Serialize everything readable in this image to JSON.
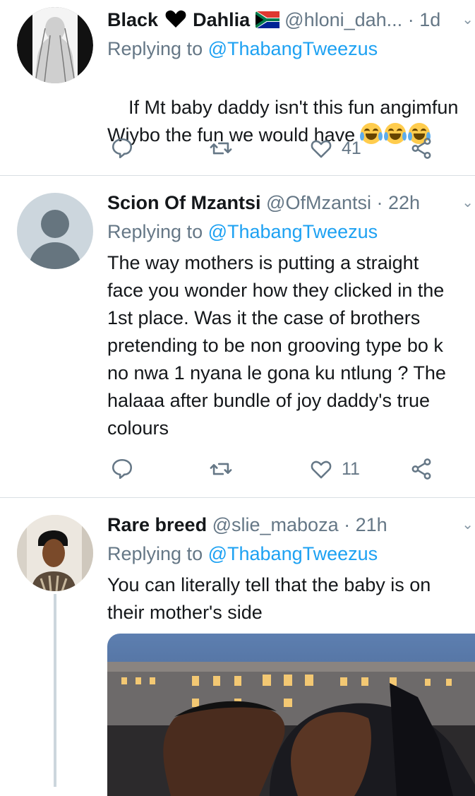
{
  "tweets": [
    {
      "name": "Black",
      "name_suffix": "Dahlia",
      "handle": "@hloni_dah...",
      "time": "1d",
      "reply_prefix": "Replying to",
      "reply_to": "@ThabangTweezus",
      "text": "If Mt baby daddy isn't this fun angimfun\nWiybo the fun we would have",
      "emojis": [
        "face-with-tears-of-joy",
        "face-with-tears-of-joy",
        "face-with-tears-of-joy"
      ],
      "replies": "",
      "retweets": "",
      "likes": "41"
    },
    {
      "name": "Scion Of Mzantsi",
      "handle": "@OfMzantsi",
      "time": "22h",
      "reply_prefix": "Replying to",
      "reply_to": "@ThabangTweezus",
      "text": "The way mothers is putting a straight\nface you wonder how they clicked in the\n1st place. Was it the case of brothers\npretending to be non grooving type bo k\nno nwa 1 nyana le gona ku ntlung ? The\nhalaaa after bundle of joy daddy's true\ncolours",
      "likes": "11"
    },
    {
      "name": "Rare breed",
      "handle": "@slie_maboza",
      "time": "21h",
      "reply_prefix": "Replying to",
      "reply_to": "@ThabangTweezus",
      "text": "You can literally tell that the baby is on\ntheir mother's side"
    }
  ],
  "separator": "·",
  "icons": {
    "reply": "reply-icon",
    "retweet": "retweet-icon",
    "like": "heart-icon",
    "share": "share-icon",
    "chevron": "chevron-down-icon",
    "flag": "south-africa-flag-icon",
    "heart_emoji": "black-heart-emoji"
  },
  "colors": {
    "accent": "#1da1f2",
    "secondary_text": "#657786",
    "divider": "#d9dfe3"
  }
}
